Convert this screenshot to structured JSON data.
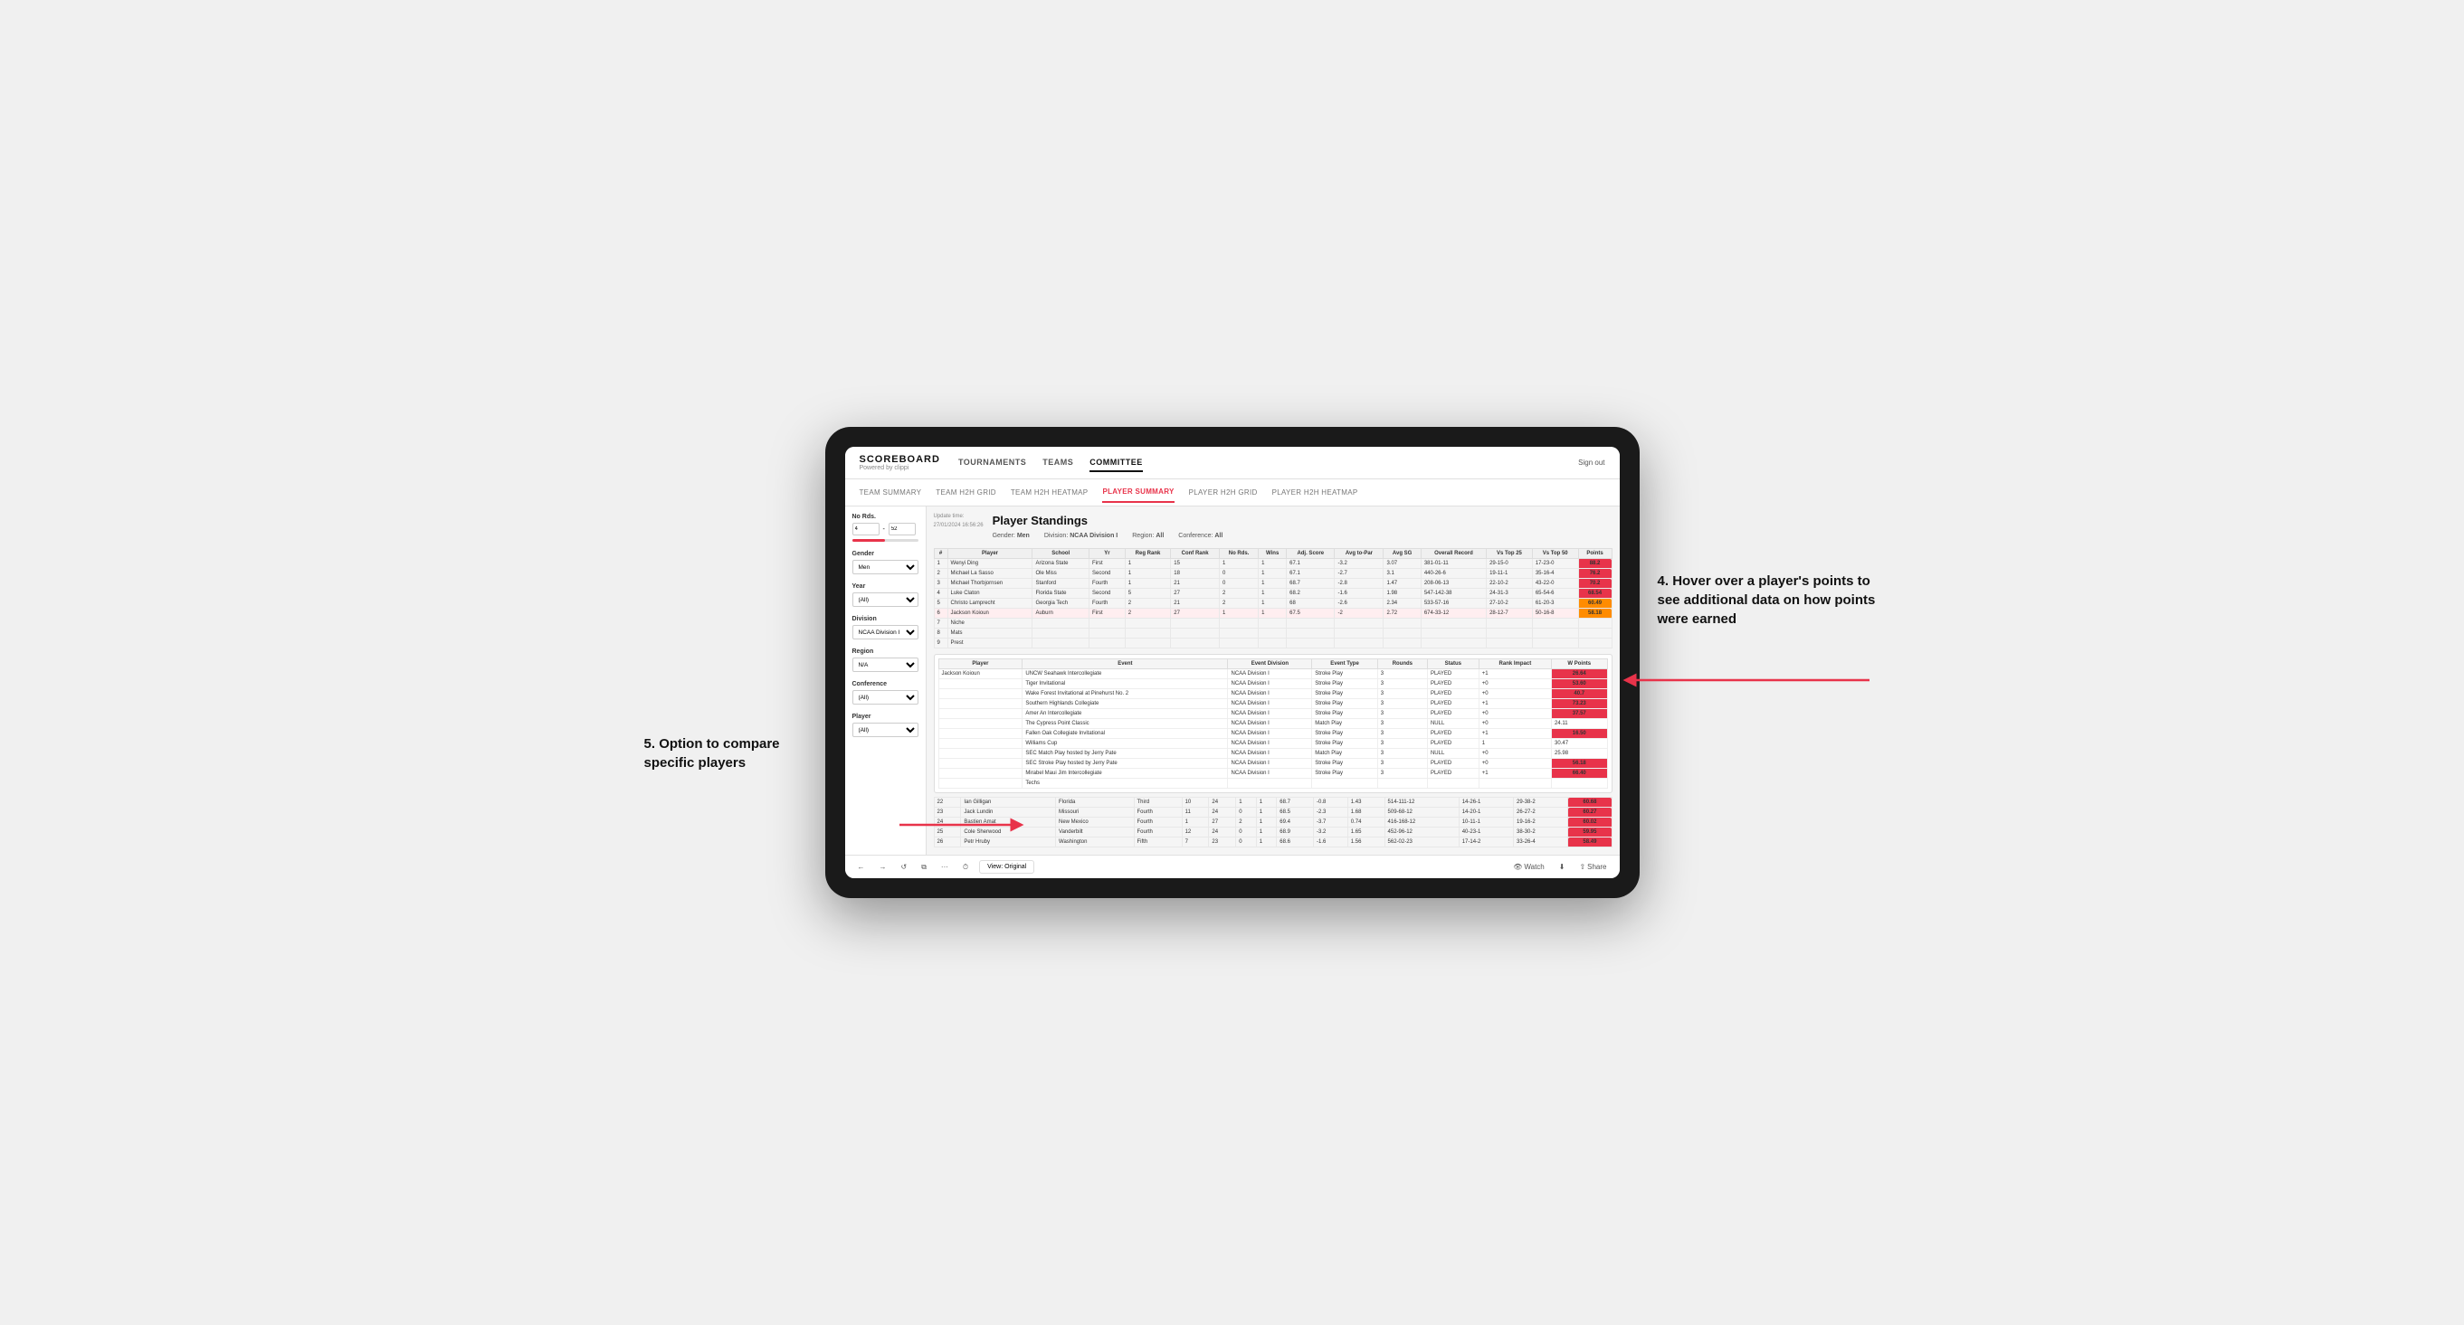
{
  "brand": {
    "title": "SCOREBOARD",
    "subtitle": "Powered by clippi"
  },
  "nav": {
    "items": [
      "TOURNAMENTS",
      "TEAMS",
      "COMMITTEE"
    ],
    "active": "COMMITTEE",
    "sign_out": "Sign out"
  },
  "sub_nav": {
    "items": [
      "TEAM SUMMARY",
      "TEAM H2H GRID",
      "TEAM H2H HEATMAP",
      "PLAYER SUMMARY",
      "PLAYER H2H GRID",
      "PLAYER H2H HEATMAP"
    ],
    "active": "PLAYER SUMMARY"
  },
  "update_time_label": "Update time:",
  "update_time_value": "27/01/2024 16:56:26",
  "section_title": "Player Standings",
  "filters": {
    "gender_label": "Gender:",
    "gender_value": "Men",
    "division_label": "Division:",
    "division_value": "NCAA Division I",
    "region_label": "Region:",
    "region_value": "All",
    "conference_label": "Conference:",
    "conference_value": "All"
  },
  "left_filters": {
    "no_rds_label": "No Rds.",
    "no_rds_min": "4",
    "no_rds_max": "52",
    "gender_label": "Gender",
    "gender_select": "Men",
    "year_label": "Year",
    "year_select": "(All)",
    "division_label": "Division",
    "division_select": "NCAA Division I",
    "region_label": "Region",
    "region_select": "N/A",
    "conference_label": "Conference",
    "conference_select": "(All)",
    "player_label": "Player",
    "player_select": "(All)"
  },
  "table": {
    "headers": [
      "#",
      "Player",
      "School",
      "Yr",
      "Reg Rank",
      "Conf Rank",
      "No Rds.",
      "Wins",
      "Adj. Score",
      "Avg to-Par",
      "Avg SG",
      "Overall Record",
      "Vs Top 25",
      "Vs Top 50",
      "Points"
    ],
    "rows": [
      {
        "rank": 1,
        "player": "Wenyi Ding",
        "school": "Arizona State",
        "yr": "First",
        "reg_rank": 1,
        "conf_rank": 15,
        "no_rds": 1,
        "wins": 1,
        "adj_score": 67.1,
        "avg_to_par": -3.2,
        "avg_sg": 3.07,
        "record": "381-01-11",
        "vs25": "29-15-0",
        "vs50": "17-23-0",
        "points": "88.2",
        "points_color": "red"
      },
      {
        "rank": 2,
        "player": "Michael La Sasso",
        "school": "Ole Miss",
        "yr": "Second",
        "reg_rank": 1,
        "conf_rank": 18,
        "no_rds": 0,
        "wins": 1,
        "adj_score": 67.1,
        "avg_to_par": -2.7,
        "avg_sg": 3.1,
        "record": "440-26-6",
        "vs25": "19-11-1",
        "vs50": "35-16-4",
        "points": "76.2",
        "points_color": "red"
      },
      {
        "rank": 3,
        "player": "Michael Thorbjornsen",
        "school": "Stanford",
        "yr": "Fourth",
        "reg_rank": 1,
        "conf_rank": 21,
        "no_rds": 0,
        "wins": 1,
        "adj_score": 68.7,
        "avg_to_par": -2.8,
        "avg_sg": 1.47,
        "record": "208-06-13",
        "vs25": "22-10-2",
        "vs50": "43-22-0",
        "points": "70.2",
        "points_color": "red"
      },
      {
        "rank": 4,
        "player": "Luke Claton",
        "school": "Florida State",
        "yr": "Second",
        "reg_rank": 5,
        "conf_rank": 27,
        "no_rds": 2,
        "wins": 1,
        "adj_score": 68.2,
        "avg_to_par": -1.6,
        "avg_sg": 1.98,
        "record": "547-142-38",
        "vs25": "24-31-3",
        "vs50": "65-54-6",
        "points": "68.54",
        "points_color": "red"
      },
      {
        "rank": 5,
        "player": "Christo Lamprecht",
        "school": "Georgia Tech",
        "yr": "Fourth",
        "reg_rank": 2,
        "conf_rank": 21,
        "no_rds": 2,
        "wins": 1,
        "adj_score": 68.0,
        "avg_to_par": -2.6,
        "avg_sg": 2.34,
        "record": "533-57-16",
        "vs25": "27-10-2",
        "vs50": "61-20-3",
        "points": "60.49",
        "points_color": "orange"
      },
      {
        "rank": 6,
        "player": "Jackson Koioun",
        "school": "Auburn",
        "yr": "First",
        "reg_rank": 2,
        "conf_rank": 27,
        "no_rds": 1,
        "wins": 1,
        "adj_score": 67.5,
        "avg_to_par": -2.0,
        "avg_sg": 2.72,
        "record": "674-33-12",
        "vs25": "28-12-7",
        "vs50": "50-16-8",
        "points": "58.18",
        "points_color": "orange"
      },
      {
        "rank": 7,
        "player": "Niche",
        "school": "",
        "yr": "",
        "reg_rank": null,
        "conf_rank": null,
        "no_rds": null,
        "wins": null,
        "adj_score": null,
        "avg_to_par": null,
        "avg_sg": null,
        "record": "",
        "vs25": "",
        "vs50": "",
        "points": "",
        "points_color": "none"
      },
      {
        "rank": 8,
        "player": "Mats",
        "school": "",
        "yr": "",
        "reg_rank": null,
        "conf_rank": null,
        "no_rds": null,
        "wins": null,
        "adj_score": null,
        "avg_to_par": null,
        "avg_sg": null,
        "record": "",
        "vs25": "",
        "vs50": "",
        "points": "",
        "points_color": "none"
      },
      {
        "rank": 9,
        "player": "Prest",
        "school": "",
        "yr": "",
        "reg_rank": null,
        "conf_rank": null,
        "no_rds": null,
        "wins": null,
        "adj_score": null,
        "avg_to_par": null,
        "avg_sg": null,
        "record": "",
        "vs25": "",
        "vs50": "",
        "points": "",
        "points_color": "none"
      }
    ]
  },
  "hover_table": {
    "player_label": "Jackson Koioun",
    "headers": [
      "Player",
      "Event",
      "Event Division",
      "Event Type",
      "Rounds",
      "Status",
      "Rank Impact",
      "W Points"
    ],
    "rows": [
      {
        "player": "Jackson Koioun",
        "event": "UNCW Seahawk Intercollegiate",
        "event_div": "NCAA Division I",
        "event_type": "Stroke Play",
        "rounds": 3,
        "status": "PLAYED",
        "rank_impact": "+1",
        "points": "26.64",
        "points_color": "red"
      },
      {
        "player": "",
        "event": "Tiger Invitational",
        "event_div": "NCAA Division I",
        "event_type": "Stroke Play",
        "rounds": 3,
        "status": "PLAYED",
        "rank_impact": "+0",
        "points": "53.60",
        "points_color": "red"
      },
      {
        "player": "",
        "event": "Wake Forest Invitational at Pinehurst No. 2",
        "event_div": "NCAA Division I",
        "event_type": "Stroke Play",
        "rounds": 3,
        "status": "PLAYED",
        "rank_impact": "+0",
        "points": "40.7",
        "points_color": "red"
      },
      {
        "player": "",
        "event": "Southern Highlands Collegiate",
        "event_div": "NCAA Division I",
        "event_type": "Stroke Play",
        "rounds": 3,
        "status": "PLAYED",
        "rank_impact": "+1",
        "points": "73.23",
        "points_color": "red"
      },
      {
        "player": "",
        "event": "Amer An Intercollegiate",
        "event_div": "NCAA Division I",
        "event_type": "Stroke Play",
        "rounds": 3,
        "status": "PLAYED",
        "rank_impact": "+0",
        "points": "37.57",
        "points_color": "red"
      },
      {
        "player": "",
        "event": "The Cypress Point Classic",
        "event_div": "NCAA Division I",
        "event_type": "Match Play",
        "rounds": 3,
        "status": "NULL",
        "rank_impact": "+0",
        "points": "24.11",
        "points_color": "none"
      },
      {
        "player": "",
        "event": "Fallen Oak Collegiate Invitational",
        "event_div": "NCAA Division I",
        "event_type": "Stroke Play",
        "rounds": 3,
        "status": "PLAYED",
        "rank_impact": "+1",
        "points": "16.50",
        "points_color": "red"
      },
      {
        "player": "",
        "event": "Williams Cup",
        "event_div": "NCAA Division I",
        "event_type": "Stroke Play",
        "rounds": 3,
        "status": "PLAYED",
        "rank_impact": "1",
        "points": "30.47",
        "points_color": "none"
      },
      {
        "player": "",
        "event": "SEC Match Play hosted by Jerry Pate",
        "event_div": "NCAA Division I",
        "event_type": "Match Play",
        "rounds": 3,
        "status": "NULL",
        "rank_impact": "+0",
        "points": "25.98",
        "points_color": "none"
      },
      {
        "player": "",
        "event": "SEC Stroke Play hosted by Jerry Pate",
        "event_div": "NCAA Division I",
        "event_type": "Stroke Play",
        "rounds": 3,
        "status": "PLAYED",
        "rank_impact": "+0",
        "points": "56.18",
        "points_color": "red"
      },
      {
        "player": "",
        "event": "Mirabel Maui Jim Intercollegiate",
        "event_div": "NCAA Division I",
        "event_type": "Stroke Play",
        "rounds": 3,
        "status": "PLAYED",
        "rank_impact": "+1",
        "points": "66.40",
        "points_color": "red"
      },
      {
        "player": "",
        "event": "Techs",
        "event_div": "",
        "event_type": "",
        "rounds": null,
        "status": "",
        "rank_impact": "",
        "points": "",
        "points_color": "none"
      }
    ]
  },
  "additional_rows": [
    {
      "rank": 22,
      "player": "Ian Gilligan",
      "school": "Florida",
      "yr": "Third",
      "reg_rank": 10,
      "conf_rank": 24,
      "no_rds": 1,
      "wins": 1,
      "adj_score": 68.7,
      "avg_to_par": -0.8,
      "avg_sg": 1.43,
      "record": "514-111-12",
      "vs25": "14-26-1",
      "vs50": "29-38-2",
      "points": "60.68"
    },
    {
      "rank": 23,
      "player": "Jack Lundin",
      "school": "Missouri",
      "yr": "Fourth",
      "reg_rank": 11,
      "conf_rank": 24,
      "no_rds": 0,
      "wins": 1,
      "adj_score": 68.5,
      "avg_to_par": -2.3,
      "avg_sg": 1.68,
      "record": "509-68-12",
      "vs25": "14-20-1",
      "vs50": "26-27-2",
      "points": "60.27"
    },
    {
      "rank": 24,
      "player": "Bastien Amat",
      "school": "New Mexico",
      "yr": "Fourth",
      "reg_rank": 1,
      "conf_rank": 27,
      "no_rds": 2,
      "wins": 1,
      "adj_score": 69.4,
      "avg_to_par": -3.7,
      "avg_sg": 0.74,
      "record": "416-168-12",
      "vs25": "10-11-1",
      "vs50": "19-16-2",
      "points": "60.02"
    },
    {
      "rank": 25,
      "player": "Cole Sherwood",
      "school": "Vanderbilt",
      "yr": "Fourth",
      "reg_rank": 12,
      "conf_rank": 24,
      "no_rds": 0,
      "wins": 1,
      "adj_score": 68.9,
      "avg_to_par": -3.2,
      "avg_sg": 1.65,
      "record": "452-96-12",
      "vs25": "40-23-1",
      "vs50": "38-30-2",
      "points": "59.95"
    },
    {
      "rank": 26,
      "player": "Petr Hruby",
      "school": "Washington",
      "yr": "Fifth",
      "reg_rank": 7,
      "conf_rank": 23,
      "no_rds": 0,
      "wins": 1,
      "adj_score": 68.6,
      "avg_to_par": -1.6,
      "avg_sg": 1.56,
      "record": "562-02-23",
      "vs25": "17-14-2",
      "vs50": "33-26-4",
      "points": "58.49"
    }
  ],
  "toolbar": {
    "back": "←",
    "forward": "→",
    "refresh": "↺",
    "copy": "⧉",
    "more": "···",
    "clock": "⏱",
    "view_label": "View: Original",
    "watch_label": "Watch",
    "share_label": "Share",
    "download_label": "⬇"
  },
  "annotations": {
    "right": {
      "number": "4.",
      "text": "Hover over a player's points to see additional data on how points were earned"
    },
    "left": {
      "number": "5.",
      "text": "Option to compare specific players"
    }
  }
}
